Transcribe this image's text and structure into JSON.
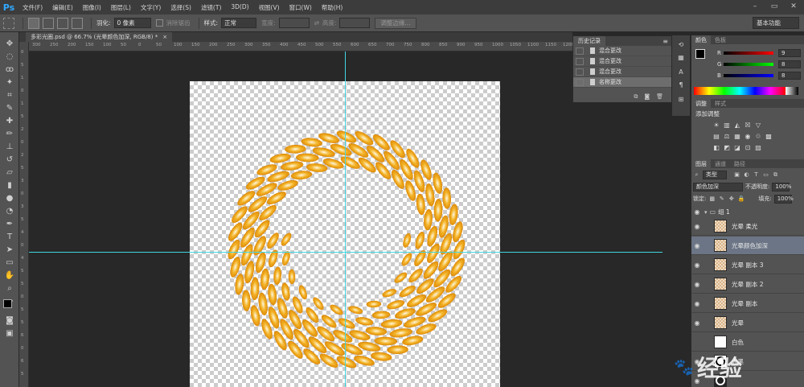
{
  "app": {
    "logo": "Ps"
  },
  "menu": [
    "文件(F)",
    "编辑(E)",
    "图像(I)",
    "图层(L)",
    "文字(Y)",
    "选择(S)",
    "滤镜(T)",
    "3D(D)",
    "视图(V)",
    "窗口(W)",
    "帮助(H)"
  ],
  "window_controls": {
    "minimize": "–",
    "maximize": "▭",
    "close": "✕"
  },
  "options": {
    "feather_label": "羽化:",
    "feather_value": "0 像素",
    "antialias_label": "消除锯齿",
    "style_label": "样式:",
    "style_value": "正常",
    "width_label": "宽度:",
    "height_label": "高度:",
    "refine_edge": "调整边缘...",
    "workspace": "基本功能"
  },
  "document": {
    "tab_title": "多彩光圈.psd @ 66.7% (光晕颜色加深, RGB/8) *",
    "tab_close": "×"
  },
  "ruler_top": [
    "300",
    "250",
    "200",
    "150",
    "100",
    "50",
    "0",
    "50",
    "100",
    "150",
    "200",
    "250",
    "300",
    "350",
    "400",
    "450",
    "500",
    "550",
    "600",
    "650",
    "700",
    "750",
    "800",
    "850",
    "900",
    "950",
    "1000",
    "1050",
    "1100",
    "1150",
    "1200",
    "1250",
    "1300",
    "1350",
    "1400",
    "1450"
  ],
  "ruler_left": [
    "0",
    "5",
    "1",
    "0",
    "1",
    "5",
    "2",
    "0",
    "2",
    "5",
    "3",
    "0",
    "3",
    "5",
    "4",
    "0",
    "4",
    "5",
    "5",
    "0",
    "5",
    "5",
    "6",
    "0",
    "6",
    "5"
  ],
  "history": {
    "tabs": [
      "历史记录"
    ],
    "items": [
      {
        "label": "混合更改",
        "selected": false
      },
      {
        "label": "混合更改",
        "selected": false
      },
      {
        "label": "混合更改",
        "selected": false
      },
      {
        "label": "名称更改",
        "selected": true
      }
    ]
  },
  "color_panel": {
    "tabs": [
      "颜色",
      "色板"
    ],
    "r_label": "R",
    "r_value": "9",
    "g_label": "G",
    "g_value": "8",
    "b_label": "B",
    "b_value": "8"
  },
  "adjustments": {
    "tabs": [
      "调整",
      "样式"
    ],
    "title": "添加调整",
    "row1": [
      "☀",
      "▥",
      "◭",
      "☒",
      "▽"
    ],
    "row2": [
      "▤",
      "⚖",
      "▦",
      "◉",
      "♲",
      "▩"
    ],
    "row3": [
      "◧",
      "◩",
      "◪",
      "⊡",
      "▨"
    ]
  },
  "layers": {
    "tabs": [
      "图层",
      "通道",
      "路径"
    ],
    "filter_value": "类型",
    "blend_mode": "颜色加深",
    "opacity_label": "不透明度:",
    "opacity_value": "100%",
    "lock_label": "锁定:",
    "fill_label": "填充:",
    "fill_value": "100%",
    "group_name": "组 1",
    "items": [
      {
        "name": "光晕 柔光",
        "thumb": "checker",
        "selected": false,
        "visible": true
      },
      {
        "name": "光晕颜色加深",
        "thumb": "checker",
        "selected": true,
        "visible": true
      },
      {
        "name": "光晕 副本 3",
        "thumb": "checker",
        "selected": false,
        "visible": true
      },
      {
        "name": "光晕 副本 2",
        "thumb": "checker",
        "selected": false,
        "visible": true
      },
      {
        "name": "光晕 副本",
        "thumb": "checker",
        "selected": false,
        "visible": true
      },
      {
        "name": "光晕",
        "thumb": "checker",
        "selected": false,
        "visible": true
      },
      {
        "name": "白色",
        "thumb": "white",
        "selected": false,
        "visible": false
      },
      {
        "name": "大黑",
        "thumb": "ring",
        "selected": false,
        "visible": true
      }
    ]
  },
  "watermark": "经验",
  "colors": {
    "accent": "#31a8ff",
    "guide": "#3fd7e0",
    "petal": "#f5b21f",
    "petal_edge": "#e08a00"
  }
}
